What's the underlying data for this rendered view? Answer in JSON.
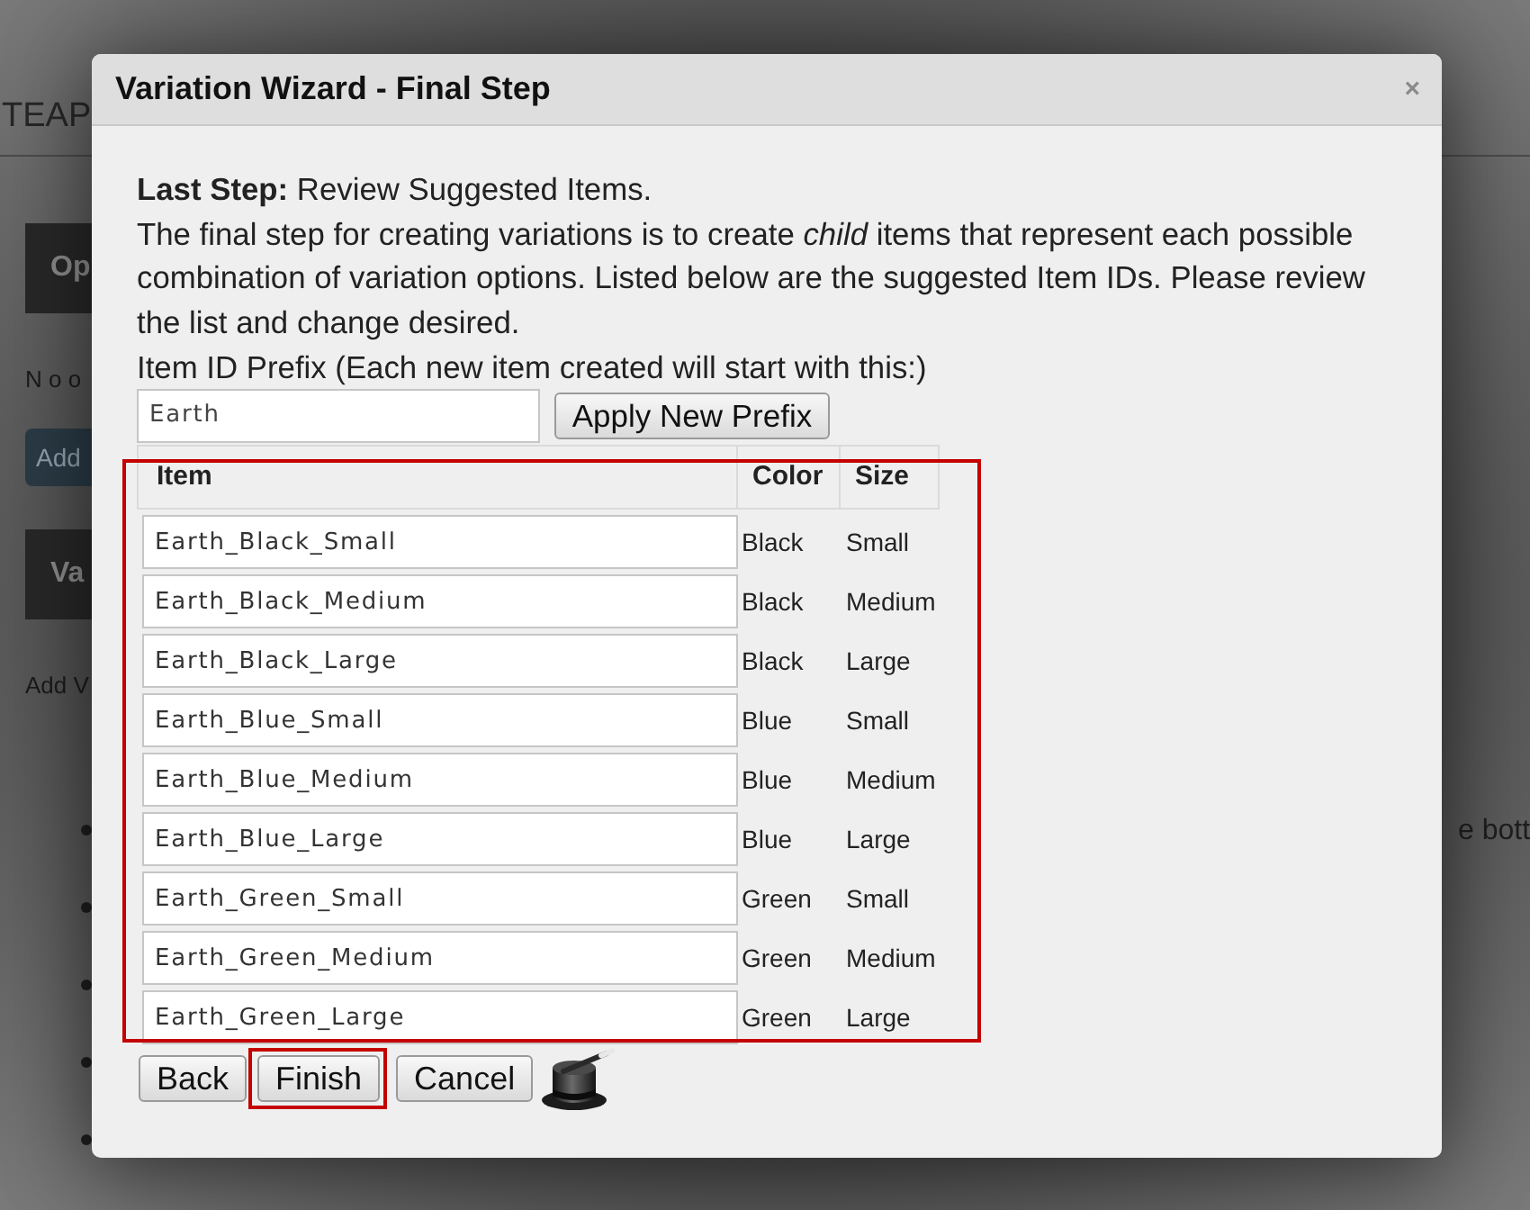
{
  "background_page": {
    "header_title": "TEAP",
    "left_items": [
      {
        "kind": "heading_bar",
        "text": "Op"
      },
      {
        "kind": "text",
        "text": "N o o"
      },
      {
        "kind": "button",
        "text": "Add"
      },
      {
        "kind": "heading_bar",
        "text": "Va"
      },
      {
        "kind": "text",
        "text": "Add V"
      }
    ],
    "right_text": "e bott"
  },
  "dialog": {
    "title": "Variation Wizard - Final Step",
    "close_label": "×",
    "intro": "**Last Step:** Review Suggested Items.",
    "description": "The final step for creating variations is to create *child* items that represent each possible combination of variation options. Listed below are the suggested Item IDs. Please review the list and change desired.",
    "prefix_label": "Item ID Prefix (Each new item created will start with this:)",
    "prefix_field": {
      "value": "Earth"
    },
    "apply_button": "Apply New Prefix",
    "table": {
      "highlighted": true,
      "columns": [
        "Item",
        "Color",
        "Size"
      ],
      "rows": [
        {
          "item": "Earth_Black_Small",
          "color_option": "Black",
          "size_option": "Small"
        },
        {
          "item": "Earth_Black_Medium",
          "color_option": "Black",
          "size_option": "Medium"
        },
        {
          "item": "Earth_Black_Large",
          "color_option": "Black",
          "size_option": "Large"
        },
        {
          "item": "Earth_Blue_Small",
          "color_option": "Blue",
          "size_option": "Small"
        },
        {
          "item": "Earth_Blue_Medium",
          "color_option": "Blue",
          "size_option": "Medium"
        },
        {
          "item": "Earth_Blue_Large",
          "color_option": "Blue",
          "size_option": "Large"
        },
        {
          "item": "Earth_Green_Small",
          "color_option": "Green",
          "size_option": "Small"
        },
        {
          "item": "Earth_Green_Medium",
          "color_option": "Green",
          "size_option": "Medium"
        },
        {
          "item": "Earth_Green_Large",
          "color_option": "Green",
          "size_option": "Large"
        }
      ]
    },
    "buttons": [
      {
        "label": "Back",
        "highlighted": false
      },
      {
        "label": "Finish",
        "highlighted": true
      },
      {
        "label": "Cancel",
        "highlighted": false
      }
    ]
  }
}
